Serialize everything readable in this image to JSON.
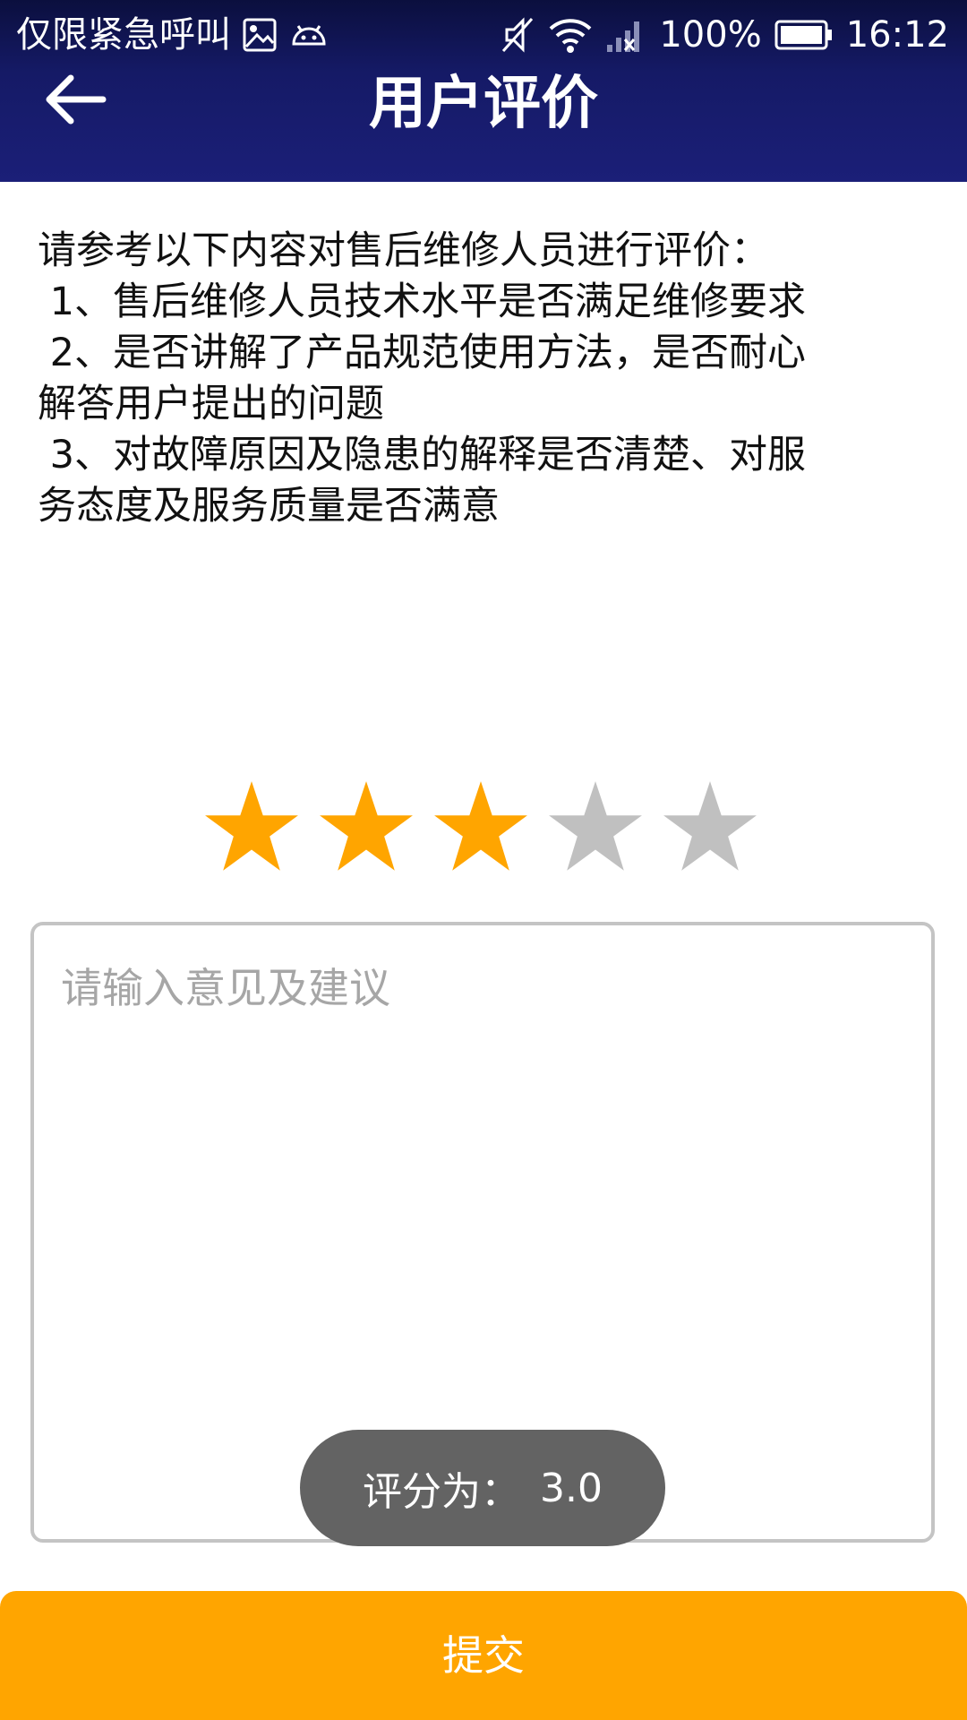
{
  "status_bar": {
    "carrier_text": "仅限紧急呼叫",
    "battery_percent": "100%",
    "time": "16:12",
    "icons": [
      "image-icon",
      "android-icon",
      "mute-icon",
      "wifi-icon",
      "no-signal-icon",
      "battery-icon"
    ]
  },
  "header": {
    "title": "用户评价",
    "back_icon": "back-arrow-icon"
  },
  "instructions": {
    "lines": [
      "请参考以下内容对售后维修人员进行评价：",
      " 1、售后维修人员技术水平是否满足维修要求",
      " 2、是否讲解了产品规范使用方法，是否耐心",
      "解答用户提出的问题",
      " 3、对故障原因及隐患的解释是否清楚、对服",
      "务态度及服务质量是否满意"
    ]
  },
  "rating": {
    "max": 5,
    "value": 3,
    "filled_color": "#FFA500",
    "empty_color": "#C0C0C0"
  },
  "comment": {
    "value": "",
    "placeholder": "请输入意见及建议"
  },
  "toast": {
    "label": "评分为：",
    "value": "3.0"
  },
  "submit": {
    "label": "提交",
    "color": "#FFA500"
  },
  "colors": {
    "header": "#1B1F78",
    "accent": "#FFA500"
  }
}
